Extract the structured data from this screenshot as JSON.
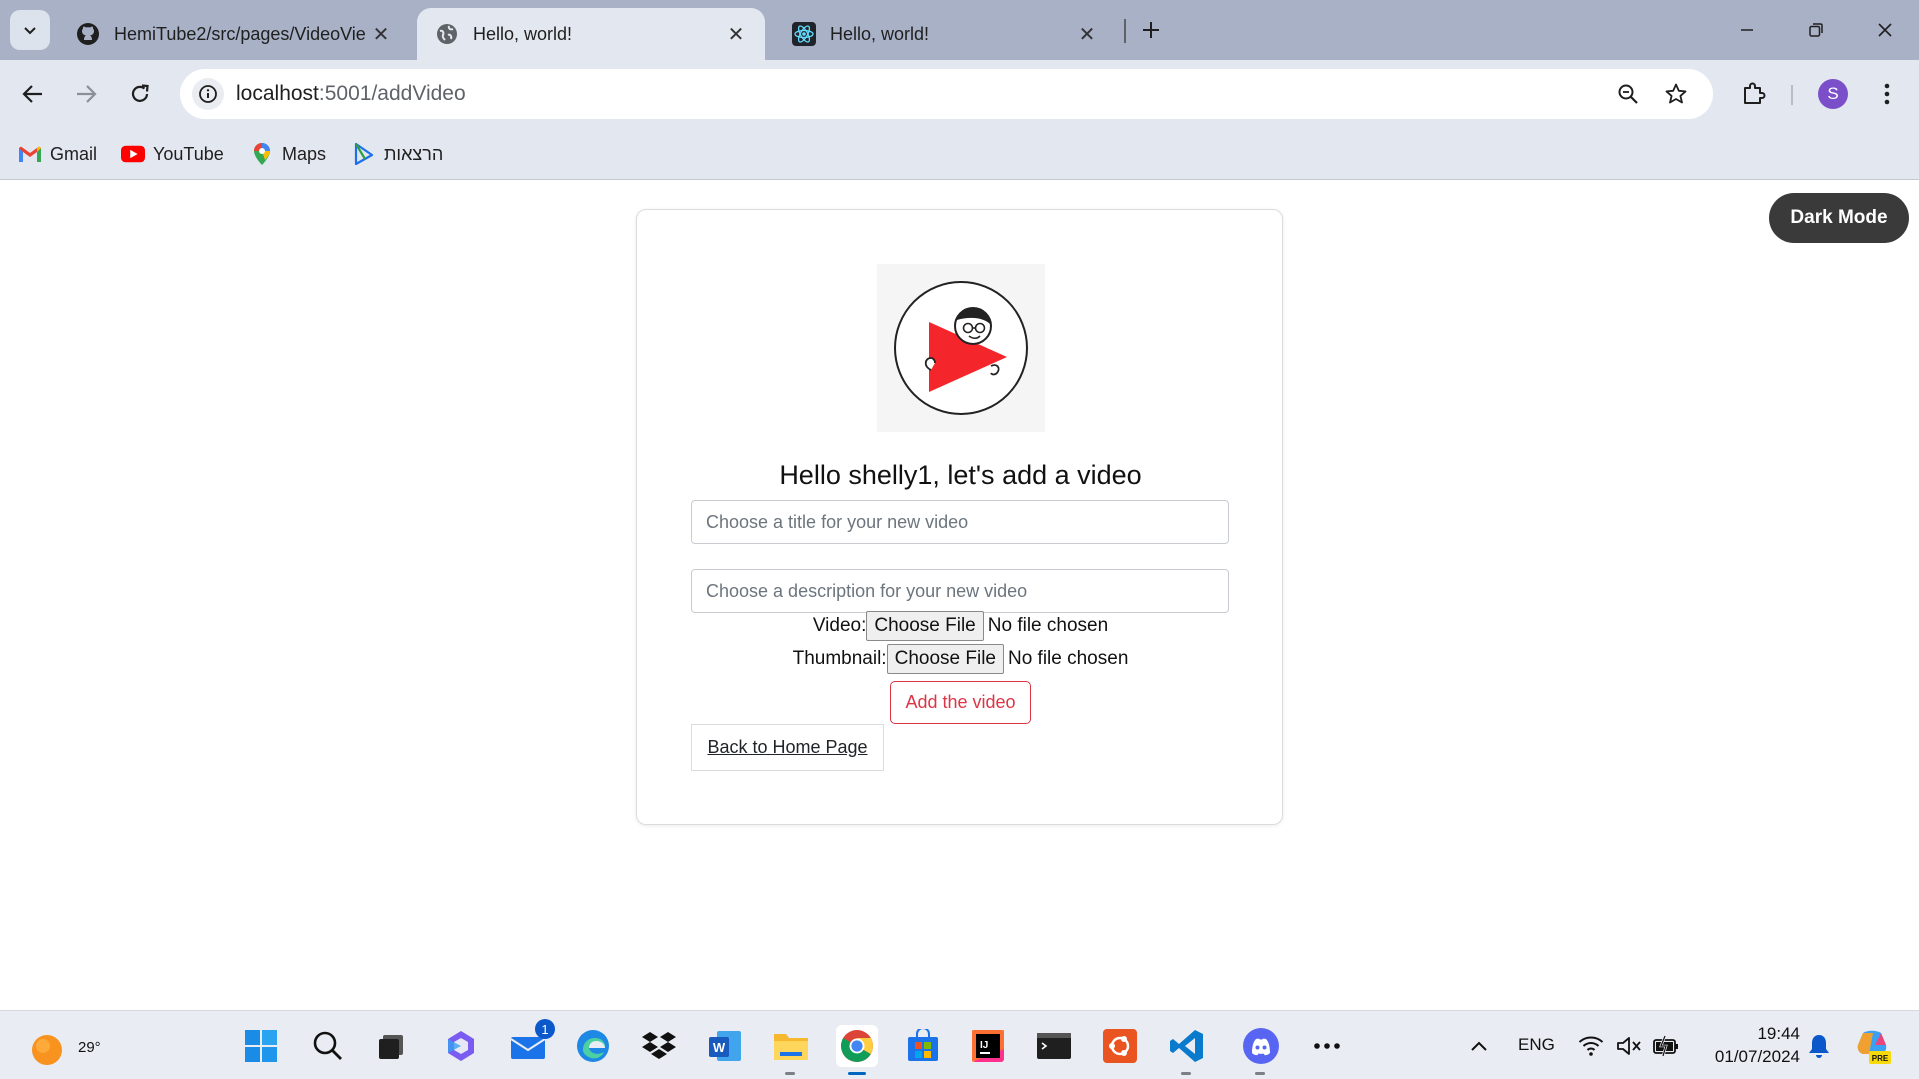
{
  "browser": {
    "tabs": [
      {
        "title": "HemiTube2/src/pages/VideoVie",
        "icon": "github-icon",
        "active": false
      },
      {
        "title": "Hello, world!",
        "icon": "globe-icon",
        "active": true
      },
      {
        "title": "Hello, world!",
        "icon": "react-icon",
        "active": false
      }
    ],
    "url_host": "localhost",
    "url_path": ":5001/addVideo",
    "profile_initial": "S",
    "bookmarks": [
      {
        "label": "Gmail",
        "icon": "gmail-icon"
      },
      {
        "label": "YouTube",
        "icon": "youtube-icon"
      },
      {
        "label": "Maps",
        "icon": "maps-icon"
      },
      {
        "label": "הרצאות",
        "icon": "bookmark-app-icon"
      }
    ]
  },
  "page": {
    "dark_mode_label": "Dark Mode",
    "heading": "Hello shelly1, let's add a video",
    "title_placeholder": "Choose a title for your new video",
    "description_placeholder": "Choose a description for your new video",
    "video_label": "Video:",
    "thumbnail_label": "Thumbnail:",
    "choose_file_label": "Choose File",
    "no_file_text": "No file chosen",
    "add_button_label": "Add the video",
    "back_link_label": "Back to Home Page"
  },
  "taskbar": {
    "weather_temp": "29°",
    "mail_badge": "1",
    "language": "ENG",
    "time": "19:44",
    "date": "01/07/2024"
  },
  "colors": {
    "accent_red": "#dc3545",
    "chrome_bg": "#e3e8f0",
    "tabstrip_bg": "#a8b1c6",
    "dark_button": "#3a3a3a"
  }
}
